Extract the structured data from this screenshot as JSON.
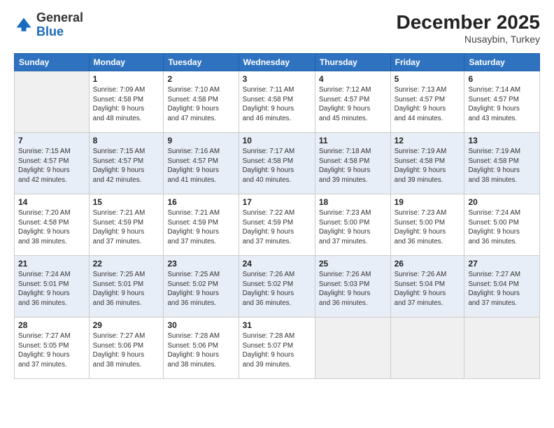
{
  "header": {
    "logo_line1": "General",
    "logo_line2": "Blue",
    "title": "December 2025",
    "subtitle": "Nusaybin, Turkey"
  },
  "columns": [
    "Sunday",
    "Monday",
    "Tuesday",
    "Wednesday",
    "Thursday",
    "Friday",
    "Saturday"
  ],
  "weeks": [
    [
      {
        "day": "",
        "info": ""
      },
      {
        "day": "1",
        "info": "Sunrise: 7:09 AM\nSunset: 4:58 PM\nDaylight: 9 hours\nand 48 minutes."
      },
      {
        "day": "2",
        "info": "Sunrise: 7:10 AM\nSunset: 4:58 PM\nDaylight: 9 hours\nand 47 minutes."
      },
      {
        "day": "3",
        "info": "Sunrise: 7:11 AM\nSunset: 4:58 PM\nDaylight: 9 hours\nand 46 minutes."
      },
      {
        "day": "4",
        "info": "Sunrise: 7:12 AM\nSunset: 4:57 PM\nDaylight: 9 hours\nand 45 minutes."
      },
      {
        "day": "5",
        "info": "Sunrise: 7:13 AM\nSunset: 4:57 PM\nDaylight: 9 hours\nand 44 minutes."
      },
      {
        "day": "6",
        "info": "Sunrise: 7:14 AM\nSunset: 4:57 PM\nDaylight: 9 hours\nand 43 minutes."
      }
    ],
    [
      {
        "day": "7",
        "info": "Sunrise: 7:15 AM\nSunset: 4:57 PM\nDaylight: 9 hours\nand 42 minutes."
      },
      {
        "day": "8",
        "info": "Sunrise: 7:15 AM\nSunset: 4:57 PM\nDaylight: 9 hours\nand 42 minutes."
      },
      {
        "day": "9",
        "info": "Sunrise: 7:16 AM\nSunset: 4:57 PM\nDaylight: 9 hours\nand 41 minutes."
      },
      {
        "day": "10",
        "info": "Sunrise: 7:17 AM\nSunset: 4:58 PM\nDaylight: 9 hours\nand 40 minutes."
      },
      {
        "day": "11",
        "info": "Sunrise: 7:18 AM\nSunset: 4:58 PM\nDaylight: 9 hours\nand 39 minutes."
      },
      {
        "day": "12",
        "info": "Sunrise: 7:19 AM\nSunset: 4:58 PM\nDaylight: 9 hours\nand 39 minutes."
      },
      {
        "day": "13",
        "info": "Sunrise: 7:19 AM\nSunset: 4:58 PM\nDaylight: 9 hours\nand 38 minutes."
      }
    ],
    [
      {
        "day": "14",
        "info": "Sunrise: 7:20 AM\nSunset: 4:58 PM\nDaylight: 9 hours\nand 38 minutes."
      },
      {
        "day": "15",
        "info": "Sunrise: 7:21 AM\nSunset: 4:59 PM\nDaylight: 9 hours\nand 37 minutes."
      },
      {
        "day": "16",
        "info": "Sunrise: 7:21 AM\nSunset: 4:59 PM\nDaylight: 9 hours\nand 37 minutes."
      },
      {
        "day": "17",
        "info": "Sunrise: 7:22 AM\nSunset: 4:59 PM\nDaylight: 9 hours\nand 37 minutes."
      },
      {
        "day": "18",
        "info": "Sunrise: 7:23 AM\nSunset: 5:00 PM\nDaylight: 9 hours\nand 37 minutes."
      },
      {
        "day": "19",
        "info": "Sunrise: 7:23 AM\nSunset: 5:00 PM\nDaylight: 9 hours\nand 36 minutes."
      },
      {
        "day": "20",
        "info": "Sunrise: 7:24 AM\nSunset: 5:00 PM\nDaylight: 9 hours\nand 36 minutes."
      }
    ],
    [
      {
        "day": "21",
        "info": "Sunrise: 7:24 AM\nSunset: 5:01 PM\nDaylight: 9 hours\nand 36 minutes."
      },
      {
        "day": "22",
        "info": "Sunrise: 7:25 AM\nSunset: 5:01 PM\nDaylight: 9 hours\nand 36 minutes."
      },
      {
        "day": "23",
        "info": "Sunrise: 7:25 AM\nSunset: 5:02 PM\nDaylight: 9 hours\nand 36 minutes."
      },
      {
        "day": "24",
        "info": "Sunrise: 7:26 AM\nSunset: 5:02 PM\nDaylight: 9 hours\nand 36 minutes."
      },
      {
        "day": "25",
        "info": "Sunrise: 7:26 AM\nSunset: 5:03 PM\nDaylight: 9 hours\nand 36 minutes."
      },
      {
        "day": "26",
        "info": "Sunrise: 7:26 AM\nSunset: 5:04 PM\nDaylight: 9 hours\nand 37 minutes."
      },
      {
        "day": "27",
        "info": "Sunrise: 7:27 AM\nSunset: 5:04 PM\nDaylight: 9 hours\nand 37 minutes."
      }
    ],
    [
      {
        "day": "28",
        "info": "Sunrise: 7:27 AM\nSunset: 5:05 PM\nDaylight: 9 hours\nand 37 minutes."
      },
      {
        "day": "29",
        "info": "Sunrise: 7:27 AM\nSunset: 5:06 PM\nDaylight: 9 hours\nand 38 minutes."
      },
      {
        "day": "30",
        "info": "Sunrise: 7:28 AM\nSunset: 5:06 PM\nDaylight: 9 hours\nand 38 minutes."
      },
      {
        "day": "31",
        "info": "Sunrise: 7:28 AM\nSunset: 5:07 PM\nDaylight: 9 hours\nand 39 minutes."
      },
      {
        "day": "",
        "info": ""
      },
      {
        "day": "",
        "info": ""
      },
      {
        "day": "",
        "info": ""
      }
    ]
  ]
}
